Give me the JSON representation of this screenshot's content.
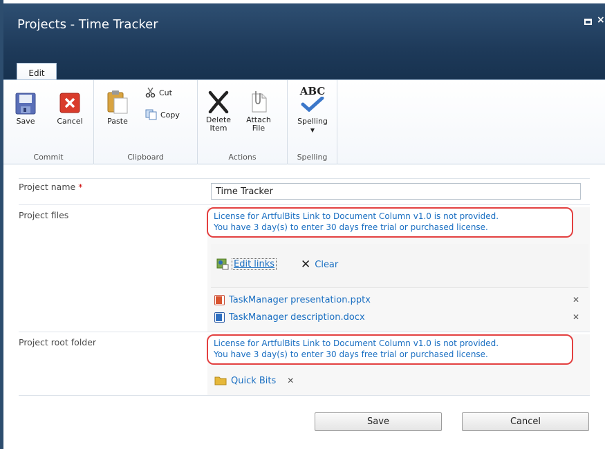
{
  "window": {
    "title": "Projects - Time Tracker",
    "maximize_icon": "maximize-icon",
    "close_glyph": "×"
  },
  "ribbon": {
    "tabs": [
      {
        "label": "Edit"
      }
    ],
    "groups": [
      {
        "label": "Commit",
        "buttons": [
          {
            "label": "Save",
            "icon": "save-icon"
          },
          {
            "label": "Cancel",
            "icon": "cancel-icon"
          }
        ]
      },
      {
        "label": "Clipboard",
        "buttons": [
          {
            "label": "Paste",
            "icon": "paste-icon"
          },
          {
            "label": "Cut",
            "icon": "cut-icon"
          },
          {
            "label": "Copy",
            "icon": "copy-icon"
          }
        ]
      },
      {
        "label": "Actions",
        "buttons": [
          {
            "label1": "Delete",
            "label2": "Item",
            "icon": "delete-icon"
          },
          {
            "label1": "Attach",
            "label2": "File",
            "icon": "attach-icon"
          }
        ]
      },
      {
        "label": "Spelling",
        "buttons": [
          {
            "label": "Spelling",
            "icon": "spelling-icon",
            "glyph": "ABC"
          }
        ]
      }
    ]
  },
  "form": {
    "fields": [
      {
        "label": "Project name",
        "required_mark": "*",
        "value": "Time Tracker"
      },
      {
        "label": "Project files"
      },
      {
        "label": "Project root folder"
      }
    ],
    "license_line1": "License for ArtfulBits Link to Document Column v1.0 is not provided.",
    "license_line2": "You have 3 day(s) to enter 30 days free trial or purchased license.",
    "edit_links_label": "Edit links",
    "clear_label": "Clear",
    "files": [
      {
        "name": "TaskManager presentation.pptx",
        "icon": "pptx-file-icon"
      },
      {
        "name": "TaskManager description.docx",
        "icon": "docx-file-icon"
      }
    ],
    "folder": {
      "name": "Quick Bits",
      "icon": "folder-icon"
    },
    "remove_glyph": "✕"
  },
  "footer": {
    "save_label": "Save",
    "cancel_label": "Cancel"
  },
  "colors": {
    "titlebar": "#1e3a5a",
    "link": "#1a6fc2",
    "license_border": "#e34040"
  }
}
